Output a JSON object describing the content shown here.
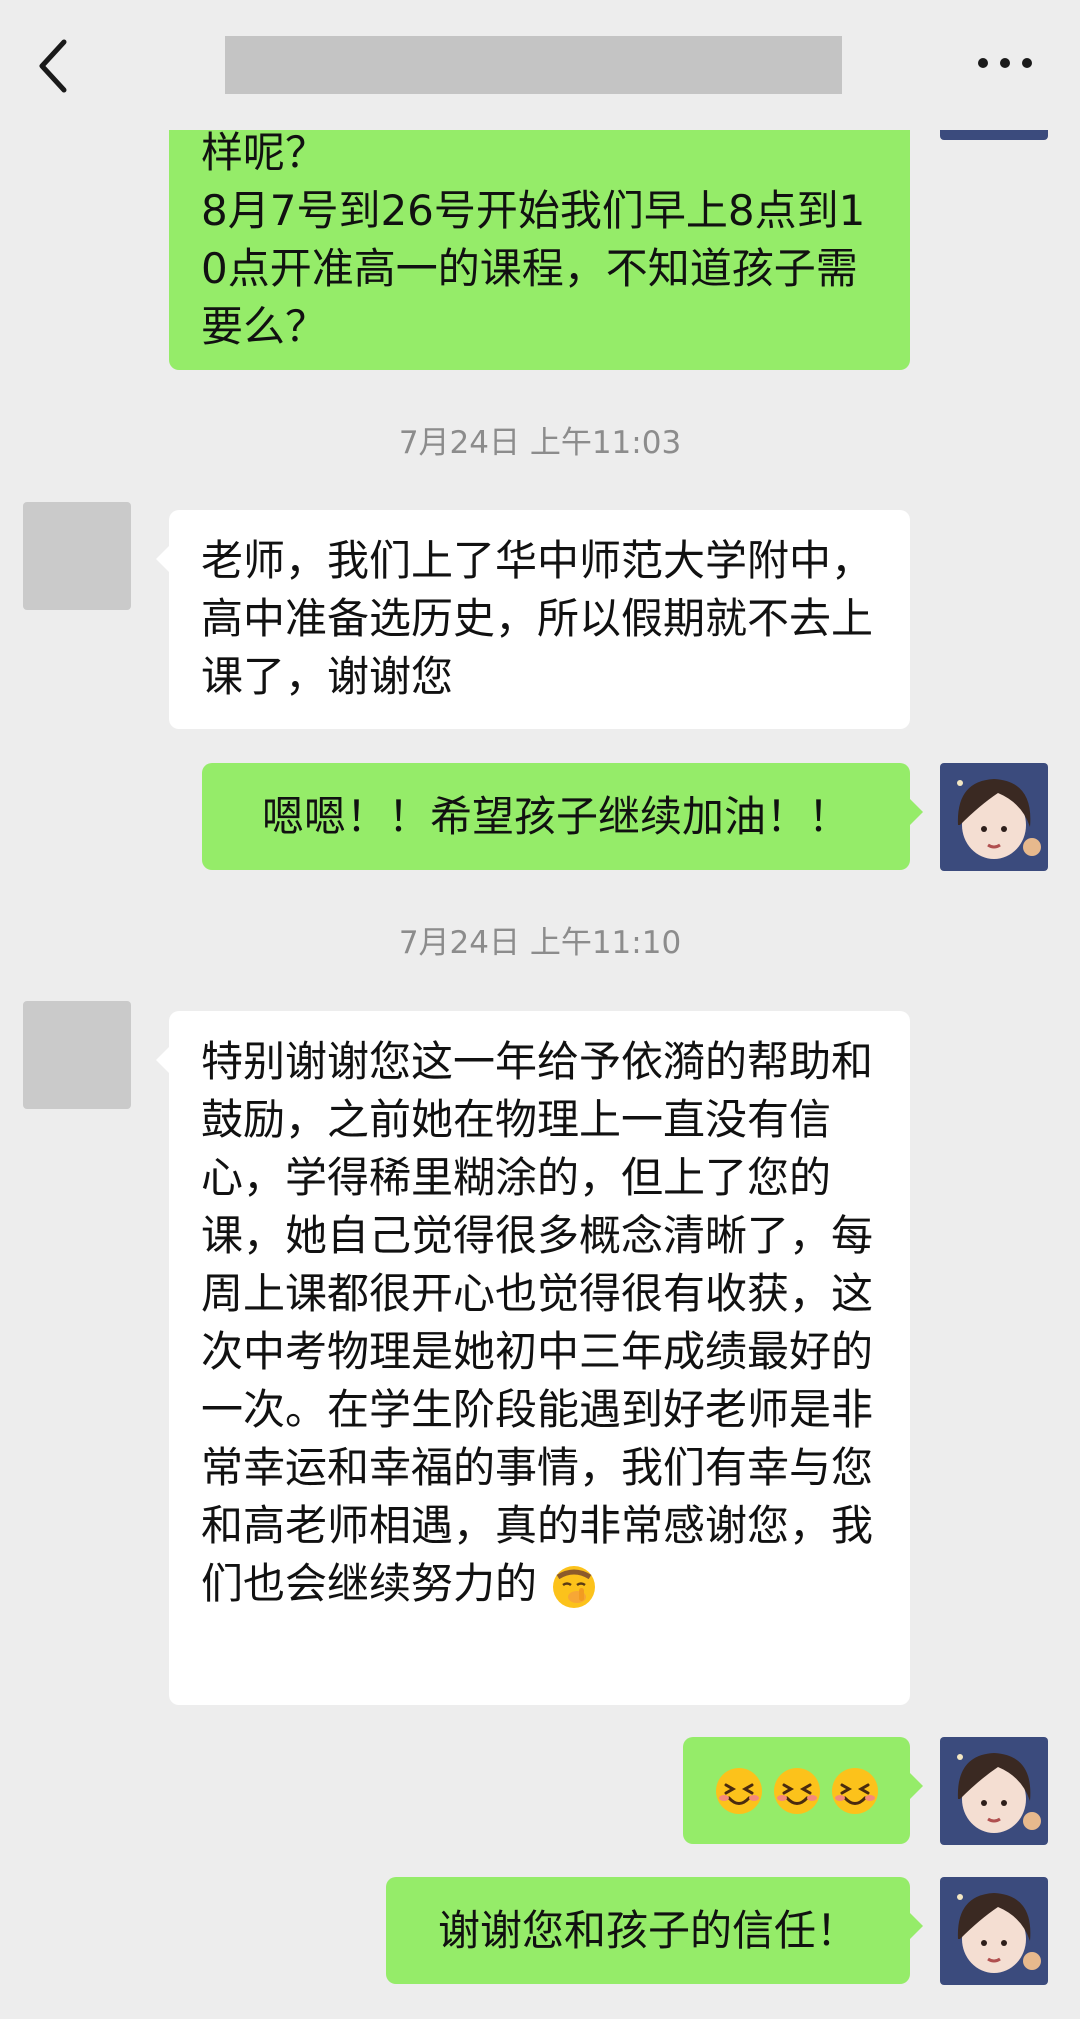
{
  "header": {
    "back_icon": "chevron-left-icon",
    "title": "",
    "more_icon": "more-dots-icon"
  },
  "messages": [
    {
      "side": "right",
      "text": "样呢？\n8月7号到26号开始我们早上8点到10点开准高一的课程，不知道孩子需要么？"
    },
    {
      "type": "time",
      "text": "7月24日 上午11:03"
    },
    {
      "side": "left",
      "text": "老师，我们上了华中师范大学附中，高中准备选历史，所以假期就不去上课了，谢谢您"
    },
    {
      "side": "right",
      "text": "嗯嗯！！希望孩子继续加油！！"
    },
    {
      "type": "time",
      "text": "7月24日 上午11:10"
    },
    {
      "side": "left",
      "text": "特别谢谢您这一年给予依漪的帮助和鼓励，之前她在物理上一直没有信心，学得稀里糊涂的，但上了您的课，她自己觉得很多概念清晰了，每周上课都很开心也觉得很有收获，这次中考物理是她初中三年成绩最好的一次。在学生阶段能遇到好老师是非常幸运和幸福的事情，我们有幸与您和高老师相遇，真的非常感谢您，我们也会继续努力的",
      "trailing_emoji": "shush-face-emoji"
    },
    {
      "side": "right",
      "emojis": [
        "grinning-squint-emoji",
        "grinning-squint-emoji",
        "grinning-squint-emoji"
      ]
    },
    {
      "side": "right",
      "text": "谢谢您和孩子的信任！"
    }
  ],
  "colors": {
    "background": "#ededed",
    "sent_bubble": "#95ec69",
    "received_bubble": "#ffffff",
    "timestamp_text": "#8c8c8c"
  }
}
